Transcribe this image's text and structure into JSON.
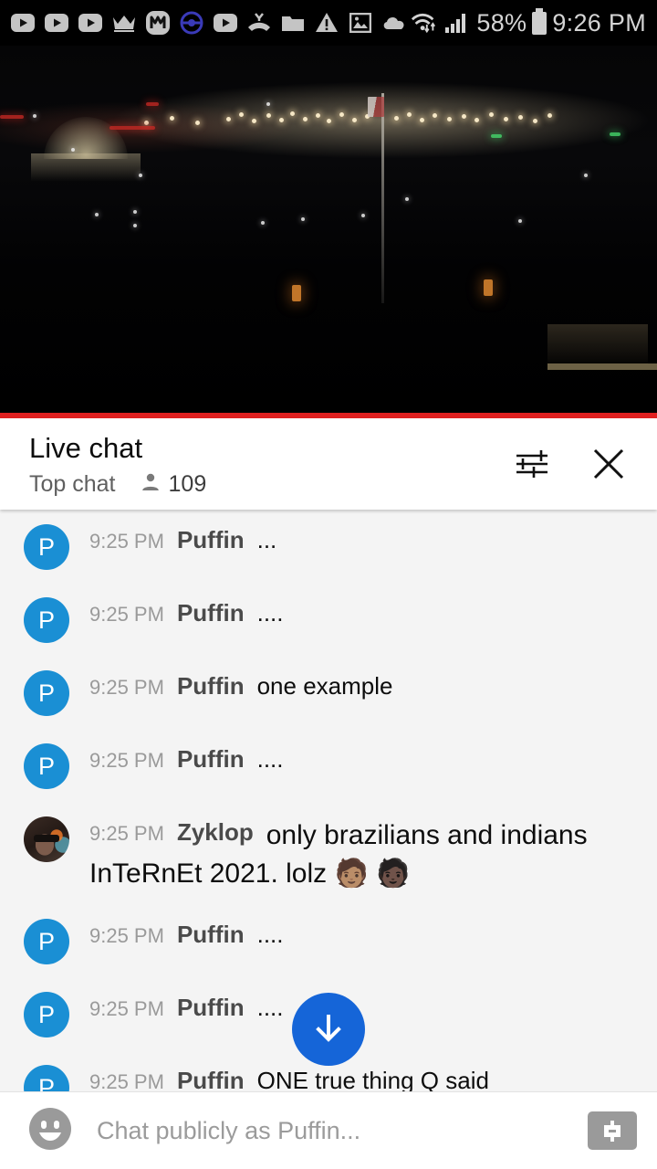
{
  "statusbar": {
    "icons": [
      {
        "name": "youtube-icon-1",
        "glyph": "youtube"
      },
      {
        "name": "youtube-icon-2",
        "glyph": "youtube"
      },
      {
        "name": "youtube-icon-3",
        "glyph": "youtube"
      },
      {
        "name": "crown-icon",
        "glyph": "crown"
      },
      {
        "name": "monzo-m-icon",
        "glyph": "m-badge"
      },
      {
        "name": "pokeball-icon",
        "glyph": "pokeball"
      },
      {
        "name": "youtube-icon-4",
        "glyph": "youtube"
      },
      {
        "name": "missed-call-icon",
        "glyph": "missed-call"
      },
      {
        "name": "folder-icon",
        "glyph": "folder"
      },
      {
        "name": "warning-icon",
        "glyph": "warning"
      },
      {
        "name": "image-icon",
        "glyph": "image"
      },
      {
        "name": "cloud-icon",
        "glyph": "cloud"
      }
    ],
    "wifi_icon": "wifi-transfer-icon",
    "signal_icon": "cell-signal-icon",
    "battery_percent": "58%",
    "battery_icon": "battery-icon",
    "clock": "9:26 PM"
  },
  "video": {
    "name": "live-video-player",
    "description": "night cityscape live stream",
    "progress_color": "#e02020"
  },
  "chat_header": {
    "title": "Live chat",
    "mode": "Top chat",
    "viewer_count": "109",
    "viewer_icon": "person-icon",
    "settings_icon": "tune-icon",
    "close_icon": "close-icon"
  },
  "messages": [
    {
      "avatar_type": "initial",
      "avatar_letter": "P",
      "time": "9:25 PM",
      "author": "Puffin",
      "text": "..."
    },
    {
      "avatar_type": "initial",
      "avatar_letter": "P",
      "time": "9:25 PM",
      "author": "Puffin",
      "text": "...."
    },
    {
      "avatar_type": "initial",
      "avatar_letter": "P",
      "time": "9:25 PM",
      "author": "Puffin",
      "text": "one example"
    },
    {
      "avatar_type": "initial",
      "avatar_letter": "P",
      "time": "9:25 PM",
      "author": "Puffin",
      "text": "...."
    },
    {
      "avatar_type": "photo",
      "avatar_letter": "",
      "time": "9:25 PM",
      "author": "Zyklop",
      "text": "only brazilians and indians InTeRnEt 2021. lolz 🧑🏽 🧑🏿"
    },
    {
      "avatar_type": "initial",
      "avatar_letter": "P",
      "time": "9:25 PM",
      "author": "Puffin",
      "text": "...."
    },
    {
      "avatar_type": "initial",
      "avatar_letter": "P",
      "time": "9:25 PM",
      "author": "Puffin",
      "text": "...."
    },
    {
      "avatar_type": "initial",
      "avatar_letter": "P",
      "time": "9:25 PM",
      "author": "Puffin",
      "text": "ONE true thing Q said"
    }
  ],
  "scroll_button": {
    "name": "scroll-to-bottom-button",
    "icon": "arrow-down-icon",
    "color": "#1565d8"
  },
  "composer": {
    "emoji_icon": "emoji-smiley-icon",
    "placeholder": "Chat publicly as Puffin...",
    "value": "",
    "superchat_icon": "dollar-icon"
  }
}
